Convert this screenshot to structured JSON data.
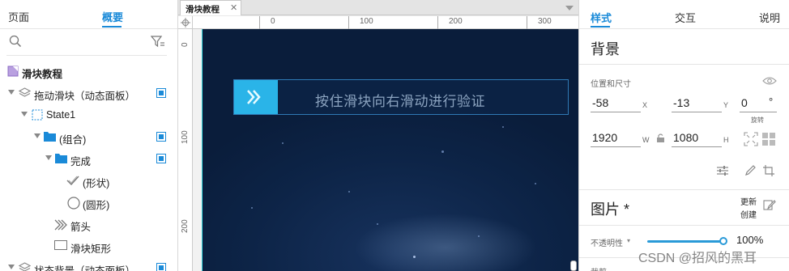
{
  "left_panel": {
    "tabs": [
      "页面",
      "概要"
    ],
    "tree": [
      {
        "label": "滑块教程",
        "icon": "page-icon"
      },
      {
        "label": "拖动滑块（动态面板）",
        "icon": "layers-icon"
      },
      {
        "label": "State1",
        "icon": "state-icon"
      },
      {
        "label": "(组合)",
        "icon": "folder-icon"
      },
      {
        "label": "完成",
        "icon": "folder-icon"
      },
      {
        "label": "(形状)",
        "icon": "check-shape-icon"
      },
      {
        "label": "(圆形)",
        "icon": "circle-icon"
      },
      {
        "label": "箭头",
        "icon": "chevrons-icon"
      },
      {
        "label": "滑块矩形",
        "icon": "rectangle-icon"
      },
      {
        "label": "状态背景（动态面板）",
        "icon": "layers-icon"
      }
    ]
  },
  "canvas": {
    "doc_tab": "滑块教程",
    "ruler_h_labels": [
      "0",
      "100",
      "200",
      "300"
    ],
    "ruler_v_labels": [
      "0",
      "100",
      "200"
    ],
    "slider_text": "按住滑块向右滑动进行验证",
    "accent": "#2ab4e8"
  },
  "right_panel": {
    "tabs": [
      "样式",
      "交互",
      "说明"
    ],
    "section_background": "背景",
    "position_size_label": "位置和尺寸",
    "x": "-58",
    "x_label": "X",
    "y": "-13",
    "y_label": "Y",
    "rotation": "0",
    "rotation_unit": "°",
    "rotation_label": "旋转",
    "w": "1920",
    "w_label": "W",
    "h": "1080",
    "h_label": "H",
    "image_section": "图片 *",
    "update_label": "更新",
    "create_label": "创建",
    "opacity_label": "不透明性",
    "opacity_value": "100%",
    "cut_label": "裁剪"
  },
  "watermark": "CSDN @招风的黑耳"
}
